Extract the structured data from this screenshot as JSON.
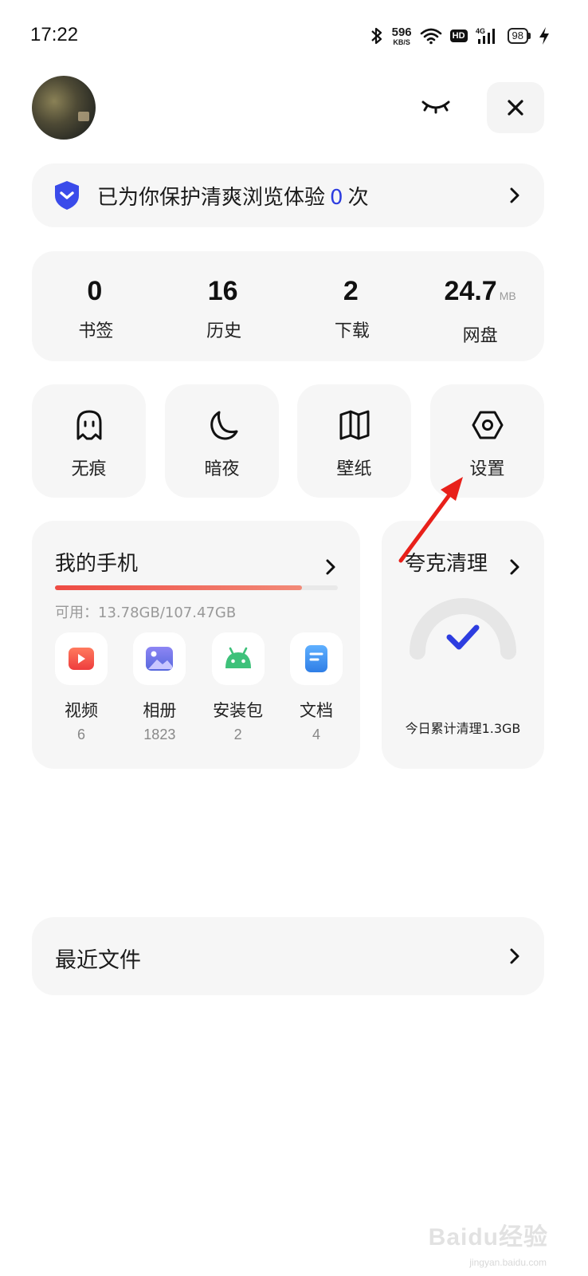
{
  "status_bar": {
    "time": "17:22",
    "net_speed": "596",
    "net_speed_unit": "KB/S",
    "hd": "HD",
    "network": "4G",
    "battery": "98"
  },
  "protection": {
    "prefix": "已为你保护清爽浏览体验",
    "count": "0",
    "suffix": "次"
  },
  "stats": [
    {
      "value": "0",
      "unit": "",
      "label": "书签"
    },
    {
      "value": "16",
      "unit": "",
      "label": "历史"
    },
    {
      "value": "2",
      "unit": "",
      "label": "下载"
    },
    {
      "value": "24.7",
      "unit": "MB",
      "label": "网盘"
    }
  ],
  "tiles": [
    {
      "label": "无痕",
      "icon": "ghost-icon"
    },
    {
      "label": "暗夜",
      "icon": "moon-icon"
    },
    {
      "label": "壁纸",
      "icon": "wallpaper-book-icon"
    },
    {
      "label": "设置",
      "icon": "hexagon-settings-icon"
    }
  ],
  "my_phone": {
    "title": "我的手机",
    "storage_text": "可用：13.78GB/107.47GB",
    "storage_used_fraction": 0.872,
    "files": [
      {
        "label": "视频",
        "count": "6",
        "icon": "video-icon",
        "color": "#f25a4a"
      },
      {
        "label": "相册",
        "count": "1823",
        "icon": "photo-album-icon",
        "color": "#6f6ee8"
      },
      {
        "label": "安装包",
        "count": "2",
        "icon": "android-icon",
        "color": "#3ec17a"
      },
      {
        "label": "文档",
        "count": "4",
        "icon": "document-icon",
        "color": "#3f95ee"
      }
    ]
  },
  "clean": {
    "title": "夸克清理",
    "caption": "今日累计清理1.3GB"
  },
  "recent_files": {
    "title": "最近文件"
  },
  "colors": {
    "accent_blue": "#2d3de0",
    "annotation_red": "#e8201a"
  },
  "watermark": {
    "brand": "Baidu经验",
    "url": "jingyan.baidu.com"
  }
}
